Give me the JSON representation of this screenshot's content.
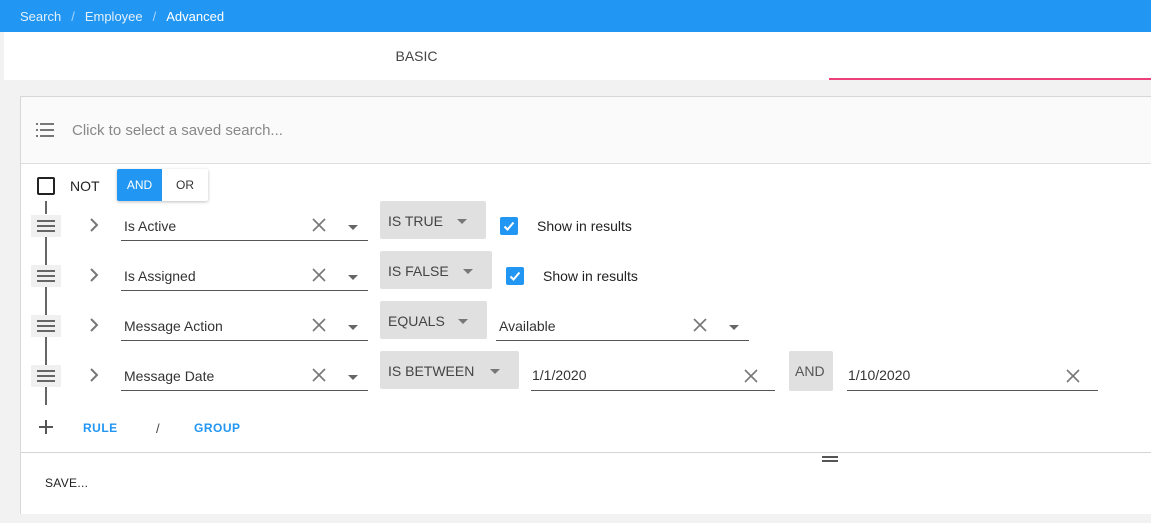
{
  "breadcrumb": [
    "Search",
    "Employee",
    "Advanced"
  ],
  "tabs": [
    {
      "label": "BASIC",
      "active": false
    },
    {
      "label": "",
      "active": true
    }
  ],
  "saved_search": {
    "placeholder": "Click to select a saved search...",
    "icon": "list-icon"
  },
  "group": {
    "not_label": "NOT",
    "not_checked": false,
    "and_label": "AND",
    "or_label": "OR",
    "combinator": "AND"
  },
  "rules": [
    {
      "field": "Is Active",
      "operator": "IS TRUE",
      "show_in_results": true,
      "show_label": "Show in results"
    },
    {
      "field": "Is Assigned",
      "operator": "IS FALSE",
      "show_in_results": true,
      "show_label": "Show in results"
    },
    {
      "field": "Message Action",
      "operator": "EQUALS",
      "value": "Available"
    },
    {
      "field": "Message Date",
      "operator": "IS BETWEEN",
      "value_from": "1/1/2020",
      "and_label": "AND",
      "value_to": "1/10/2020"
    }
  ],
  "actions": {
    "rule_label": "RULE",
    "separator": "/",
    "group_label": "GROUP"
  },
  "footer": {
    "save_label": "SAVE..."
  },
  "colors": {
    "accent": "#2196f3",
    "tab_indicator": "#ec407a",
    "operator_bg": "#e0e0e0"
  }
}
